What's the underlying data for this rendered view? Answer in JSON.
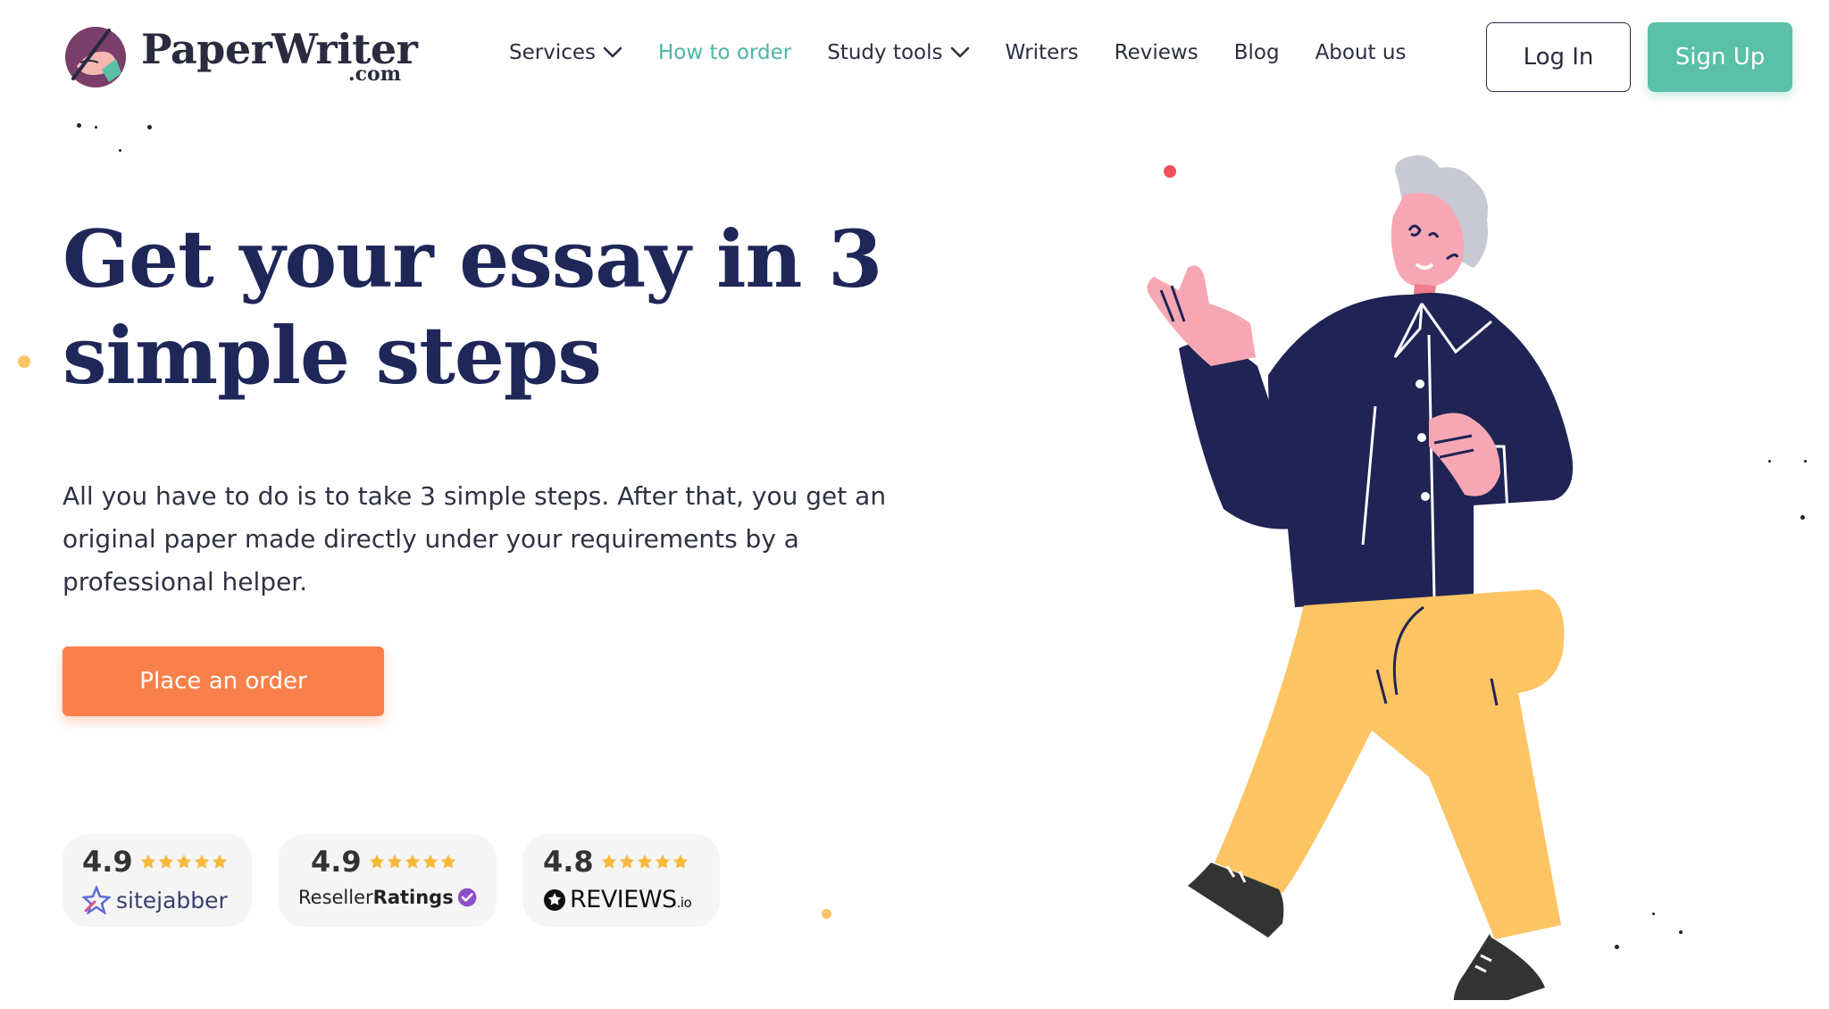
{
  "header": {
    "logo": {
      "name": "PaperWriter",
      "domain": ".com",
      "icon": "quill-hand-icon"
    },
    "nav": [
      {
        "label": "Services",
        "dropdown": true
      },
      {
        "label": "How to order",
        "active": true
      },
      {
        "label": "Study tools",
        "dropdown": true
      },
      {
        "label": "Writers"
      },
      {
        "label": "Reviews"
      },
      {
        "label": "Blog"
      },
      {
        "label": "About us"
      }
    ],
    "login_label": "Log In",
    "signup_label": "Sign Up"
  },
  "hero": {
    "title_line1": "Get your essay in 3",
    "title_line2": "simple steps",
    "subtitle": "All you have to do is to take 3 simple steps. After that, you get an original paper made directly under your requirements by a professional helper.",
    "cta_label": "Place an order",
    "illustration": "man-gesturing-illustration"
  },
  "ratings": [
    {
      "score": "4.9",
      "stars": 5,
      "brand": "sitejabber",
      "icon": "sitejabber-logo-icon"
    },
    {
      "score": "4.9",
      "stars": 5,
      "brand_part1": "Reseller",
      "brand_part2": "Ratings",
      "icon": "verified-badge-icon"
    },
    {
      "score": "4.8",
      "stars": 5,
      "brand_part1": "REVIEWS",
      "brand_part2": ".io",
      "icon": "reviews-io-star-icon"
    }
  ],
  "colors": {
    "accent": "#5bc0a8",
    "cta": "#f9804a",
    "title": "#1f2759",
    "star": "#f6b93b",
    "shirt": "#1f2455",
    "pants": "#fcc463"
  }
}
